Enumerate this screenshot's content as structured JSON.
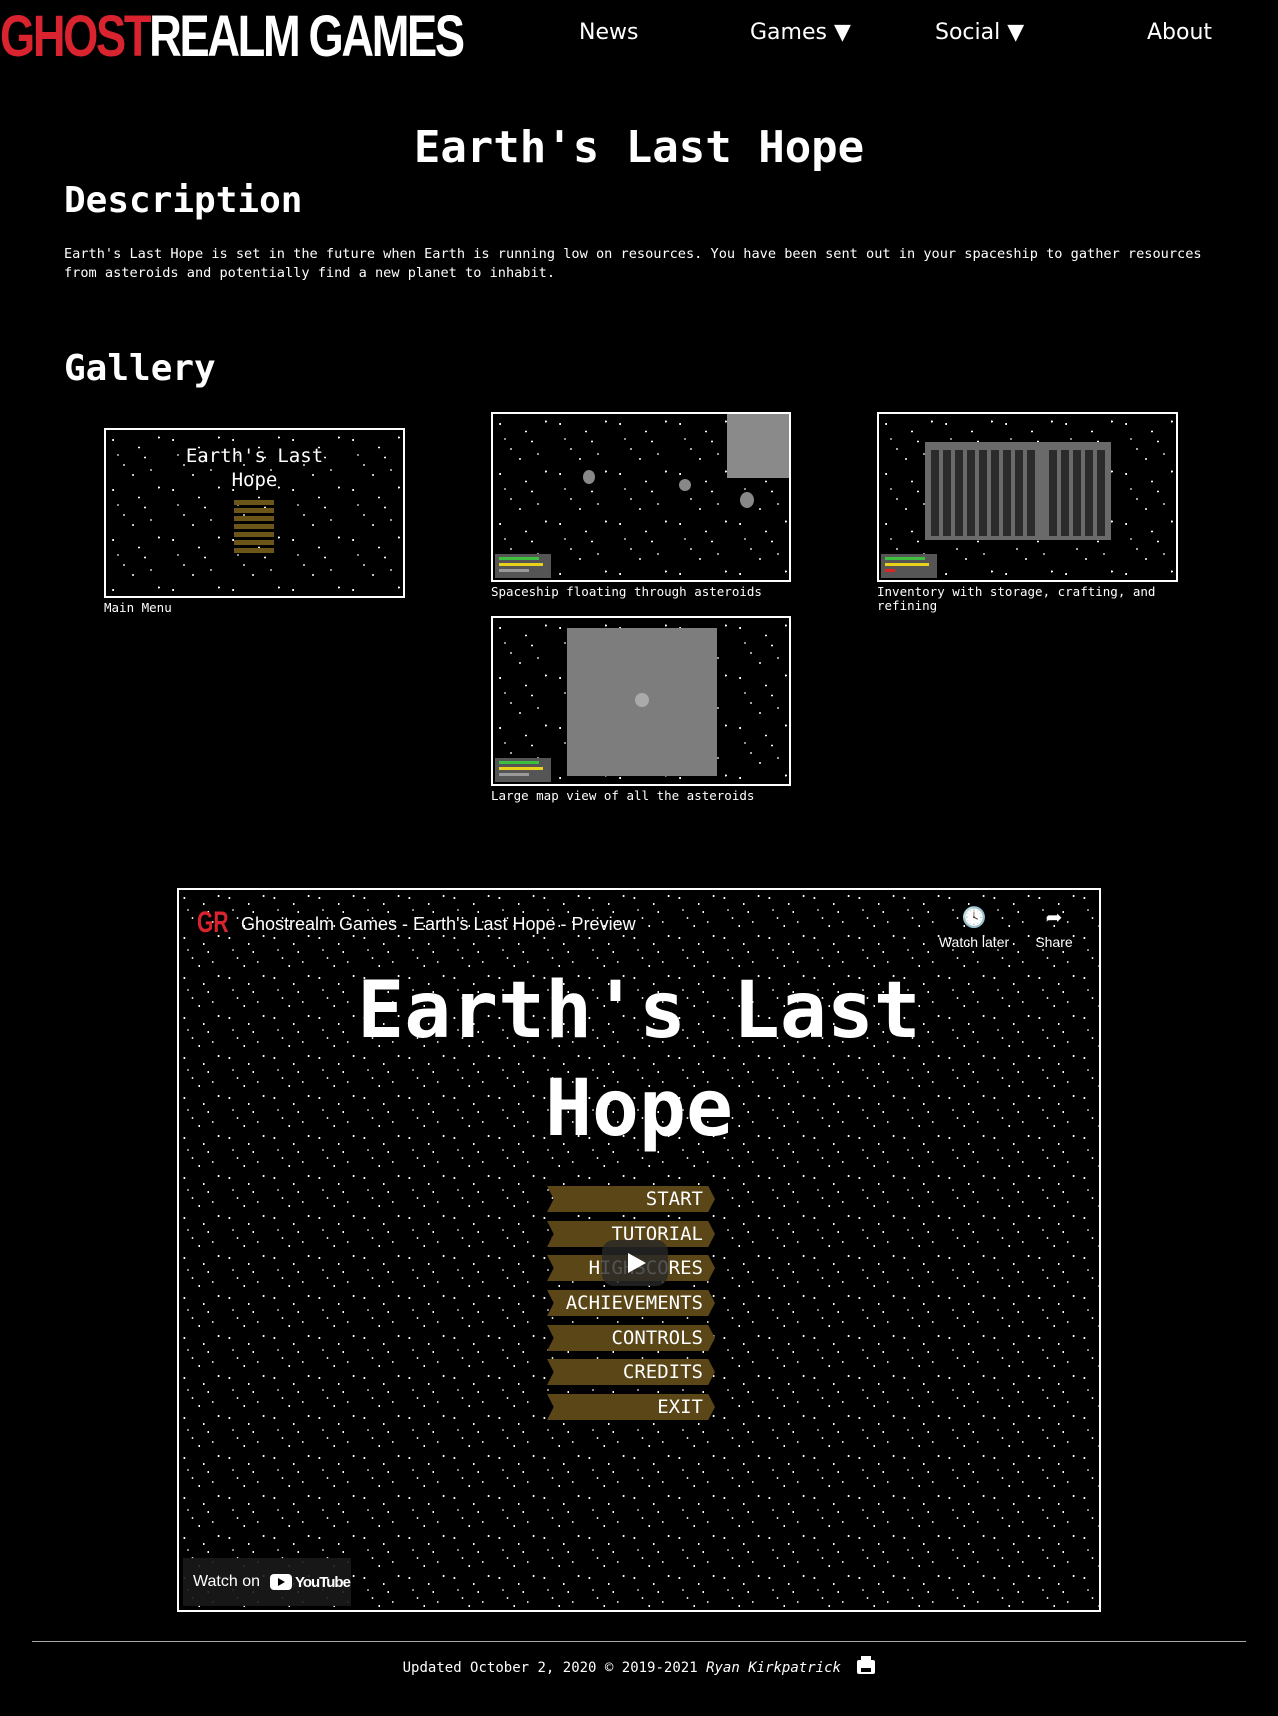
{
  "header": {
    "logo_part1": "GHOST",
    "logo_part2": "REALM GAMES",
    "nav": [
      {
        "label": "News"
      },
      {
        "label": "Games ▼"
      },
      {
        "label": "Social ▼"
      },
      {
        "label": "About"
      }
    ]
  },
  "page": {
    "title": "Earth's Last Hope",
    "description_heading": "Description",
    "description": "Earth's Last Hope is set in the future when Earth is running low on resources. You have been sent out in your spaceship to gather resources from asteroids and potentially find a new planet to inhabit.",
    "gallery_heading": "Gallery"
  },
  "gallery": [
    {
      "caption": "Main Menu",
      "thumb_title": "Earth's Last\nHope"
    },
    {
      "caption": "Spaceship floating through asteroids"
    },
    {
      "caption": "Inventory with storage, crafting, and refining"
    },
    {
      "caption": "Large map view of all the asteroids"
    }
  ],
  "video": {
    "channel_logo": "GR",
    "title": "Ghostrealm Games - Earth's Last Hope - Preview",
    "watch_later": "Watch later",
    "share": "Share",
    "game_title_line1": "Earth's Last",
    "game_title_line2": "Hope",
    "menu": [
      "START",
      "TUTORIAL",
      "HIGHSCORES",
      "ACHIEVEMENTS",
      "CONTROLS",
      "CREDITS",
      "EXIT"
    ],
    "watch_on": "Watch on",
    "youtube": "YouTube"
  },
  "footer": {
    "updated": "Updated October 2, 2020 © 2019-2021",
    "author": "Ryan Kirkpatrick"
  },
  "colors": {
    "brand_red": "#d9232e",
    "background": "#000000",
    "menu_button": "#5a4616"
  },
  "icons": [
    "clock-icon",
    "share-icon",
    "play-icon",
    "print-icon"
  ]
}
